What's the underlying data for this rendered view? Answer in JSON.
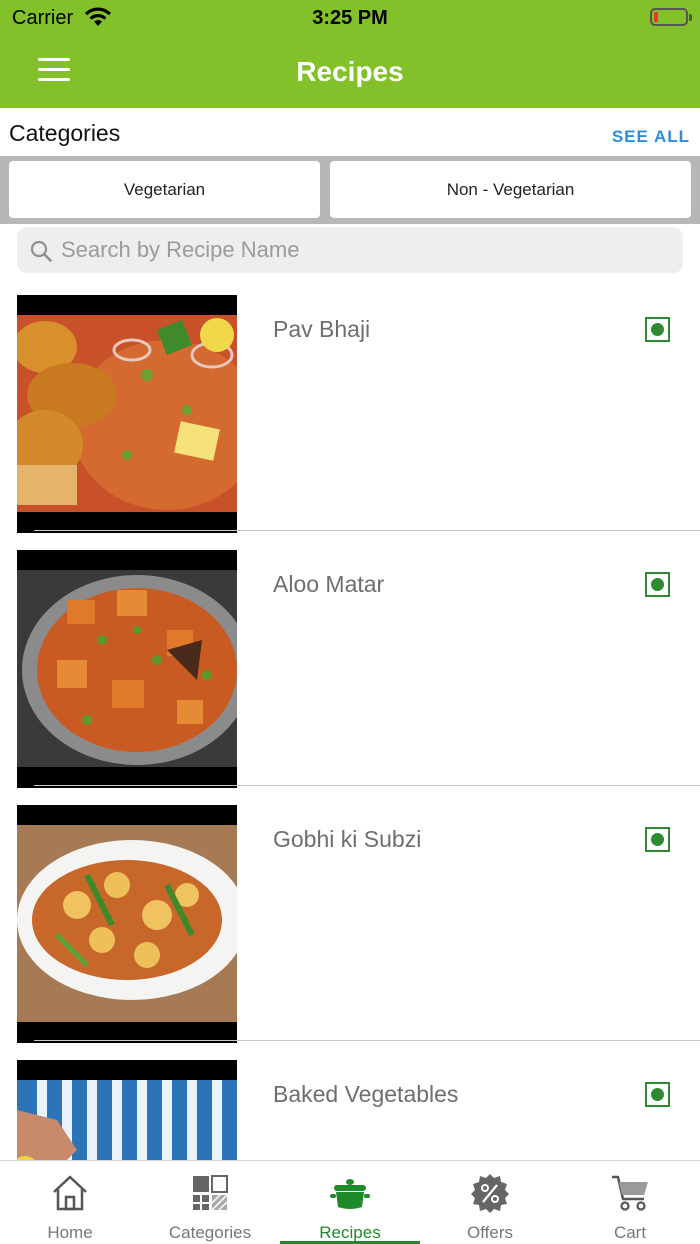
{
  "status_bar": {
    "carrier": "Carrier",
    "time": "3:25 PM"
  },
  "header": {
    "title": "Recipes",
    "menu_icon": "hamburger-menu-icon"
  },
  "categories": {
    "title": "Categories",
    "see_all": "SEE ALL",
    "items": [
      "Vegetarian",
      "Non - Vegetarian"
    ]
  },
  "search": {
    "placeholder": "Search by Recipe Name",
    "value": "",
    "icon": "search-icon"
  },
  "recipes": [
    {
      "name": "Pav Bhaji",
      "veg": true
    },
    {
      "name": "Aloo Matar",
      "veg": true
    },
    {
      "name": "Gobhi ki Subzi",
      "veg": true
    },
    {
      "name": "Baked Vegetables",
      "veg": true
    }
  ],
  "tab_bar": {
    "active": "Recipes",
    "tabs": [
      {
        "label": "Home",
        "icon": "home-icon"
      },
      {
        "label": "Categories",
        "icon": "categories-icon"
      },
      {
        "label": "Recipes",
        "icon": "cooking-pot-icon"
      },
      {
        "label": "Offers",
        "icon": "discount-badge-icon"
      },
      {
        "label": "Cart",
        "icon": "cart-icon"
      }
    ]
  },
  "colors": {
    "header_green": "#82c12a",
    "active_tab": "#1f8a2a",
    "link_blue": "#2f8de0",
    "veg_mark": "#2e8b32"
  }
}
